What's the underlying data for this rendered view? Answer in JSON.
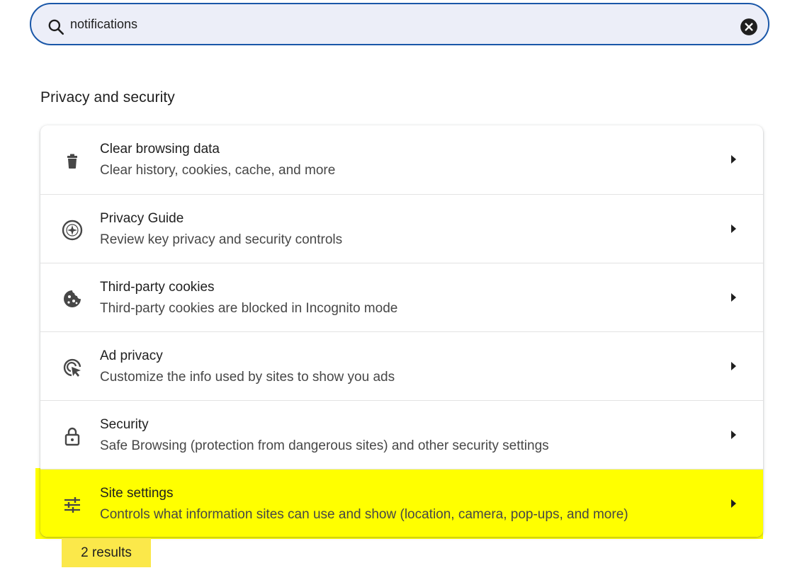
{
  "search": {
    "value": "notifications",
    "placeholder": "Search settings",
    "clear_icon": "close-circle-icon",
    "search_icon": "search-icon"
  },
  "section": {
    "title": "Privacy and security"
  },
  "rows": [
    {
      "title": "Clear browsing data",
      "subtitle": "Clear history, cookies, cache, and more",
      "icon": "trash-icon"
    },
    {
      "title": "Privacy Guide",
      "subtitle": "Review key privacy and security controls",
      "icon": "compass-icon"
    },
    {
      "title": "Third-party cookies",
      "subtitle": "Third-party cookies are blocked in Incognito mode",
      "icon": "cookie-icon"
    },
    {
      "title": "Ad privacy",
      "subtitle": "Customize the info used by sites to show you ads",
      "icon": "ad-privacy-icon"
    },
    {
      "title": "Security",
      "subtitle": "Safe Browsing (protection from dangerous sites) and other security settings",
      "icon": "lock-icon"
    },
    {
      "title": "Site settings",
      "subtitle": "Controls what information sites can use and show (location, camera, pop-ups, and more)",
      "icon": "sliders-icon",
      "highlighted": true
    }
  ],
  "results": {
    "label": "2 results"
  },
  "colors": {
    "search_border": "#1a57a8",
    "search_bg": "#eceef8",
    "highlight": "#ffff00",
    "badge": "#fbe84a"
  }
}
